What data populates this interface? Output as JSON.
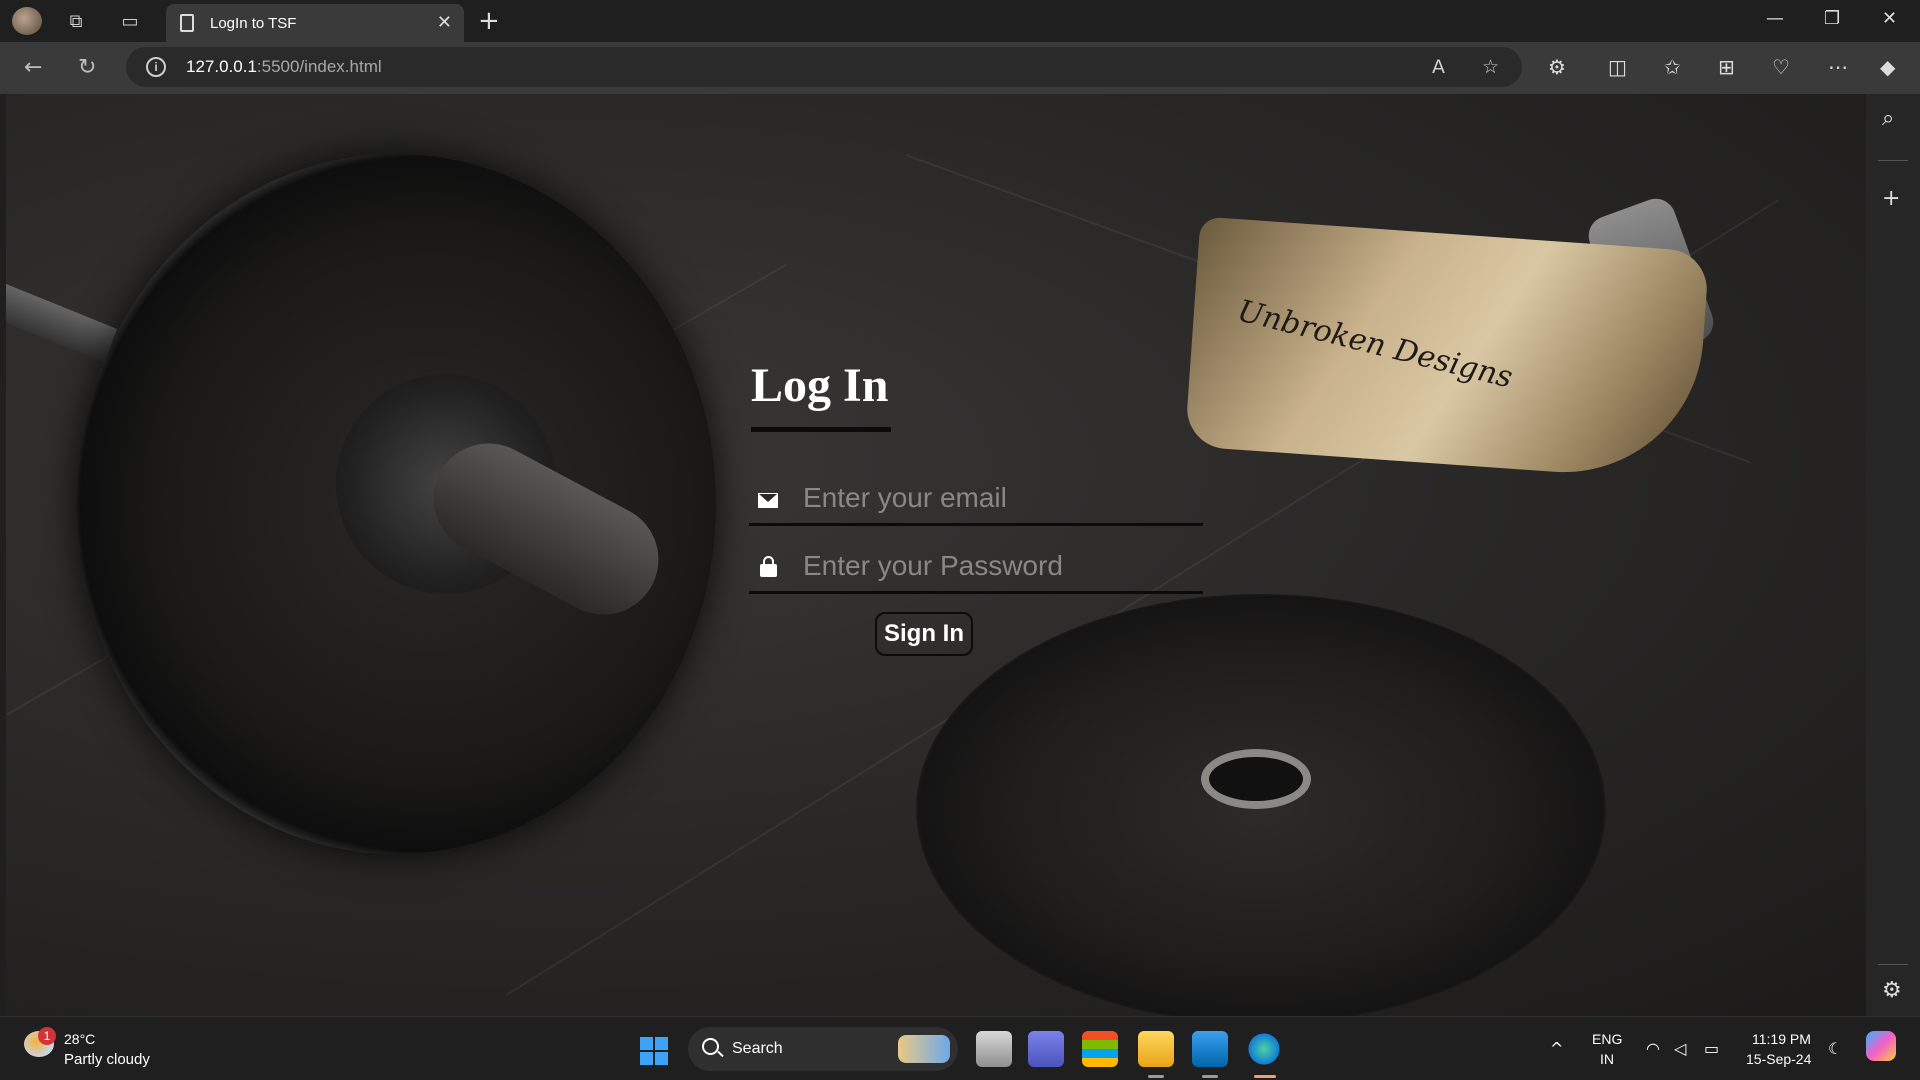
{
  "browser": {
    "tab_title": "LogIn to TSF",
    "url_host": "127.0.0.1",
    "url_path": ":5500/index.html"
  },
  "page": {
    "belt_brand": "Unbroken Designs",
    "title": "Log In",
    "email_placeholder": "Enter your email",
    "password_placeholder": "Enter your Password",
    "signin_label": "Sign In"
  },
  "taskbar": {
    "weather_badge": "1",
    "weather_temp": "28°C",
    "weather_desc": "Partly cloudy",
    "search_label": "Search",
    "lang_line1": "ENG",
    "lang_line2": "IN",
    "time": "11:19 PM",
    "date": "15-Sep-24"
  },
  "colors": {
    "accent_blue": "#3ea3f7",
    "browser_bg": "#1f1f1f",
    "tab_active": "#3a3a3a"
  }
}
